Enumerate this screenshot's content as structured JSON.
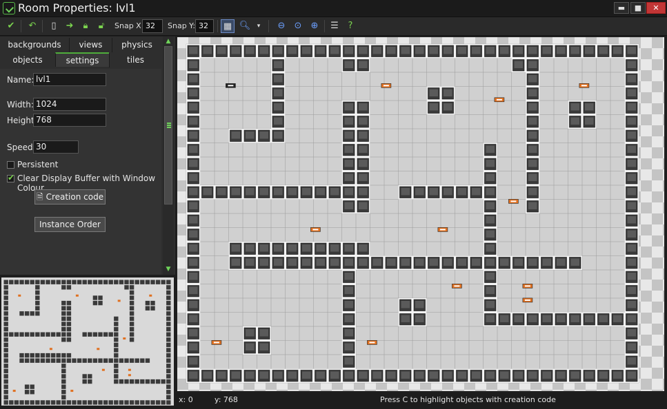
{
  "window": {
    "title": "Room Properties: lvl1",
    "minimize": "▬",
    "maximize": "■",
    "close": "✕"
  },
  "toolbar": {
    "snap_x_label": "Snap X:",
    "snap_x_value": "32",
    "snap_y_label": "Snap Y:",
    "snap_y_value": "32",
    "icons": [
      "ok-check-icon",
      "undo-icon",
      "new-document-icon",
      "shift-arrow-icon",
      "lock-icon",
      "unlock-icon",
      "grid-toggle-icon",
      "search-zoom-icon",
      "dropdown-arrow-icon",
      "zoom-out-icon",
      "zoom-reset-icon",
      "zoom-in-icon",
      "list-icon",
      "help-icon"
    ]
  },
  "tabs": {
    "row1": [
      "backgrounds",
      "views",
      "physics"
    ],
    "row2": [
      "objects",
      "settings",
      "tiles"
    ],
    "active": "settings"
  },
  "settings": {
    "name_label": "Name:",
    "name_value": "lvl1",
    "width_label": "Width:",
    "width_value": "1024",
    "height_label": "Height:",
    "height_value": "768",
    "speed_label": "Speed:",
    "speed_value": "30",
    "persistent_label": "Persistent",
    "persistent_checked": false,
    "clear_buffer_label": "Clear Display Buffer with Window Colour",
    "clear_buffer_checked": true,
    "creation_code_button": "Creation code",
    "instance_order_button": "Instance Order"
  },
  "status": {
    "x": "x: 0",
    "y": "y: 768",
    "hint": "Press C to highlight objects with creation code"
  },
  "colors": {
    "accent_green": "#6fd35a",
    "wall_dark": "#3a3a3a",
    "floor": "#d0d0d0",
    "checker_light": "#e8e8e8",
    "checker_dark": "#c4c4c4",
    "object_orange": "#e07020"
  }
}
